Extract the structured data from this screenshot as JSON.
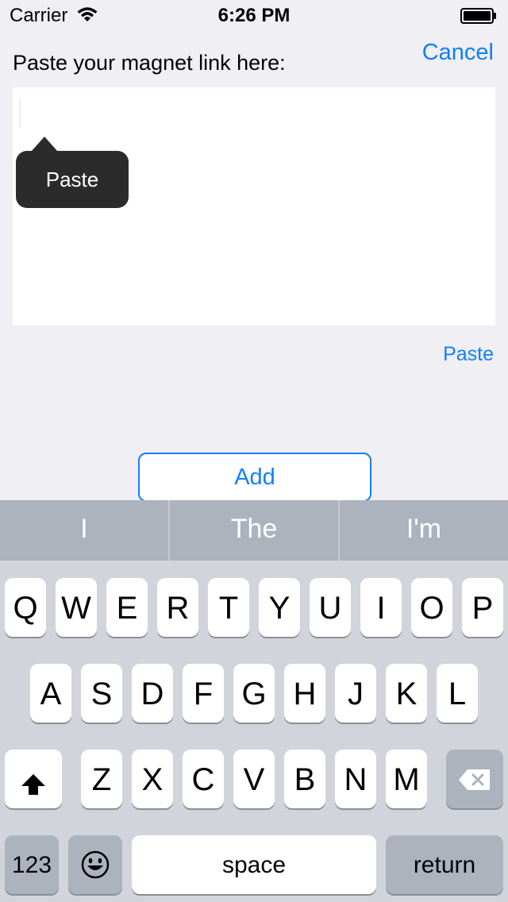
{
  "status_bar": {
    "carrier": "Carrier",
    "time": "6:26 PM",
    "wifi_icon": "wifi-icon",
    "battery_icon": "battery-icon"
  },
  "header": {
    "prompt": "Paste your magnet link here:",
    "cancel_label": "Cancel"
  },
  "text_area": {
    "value": "",
    "popup_label": "Paste"
  },
  "paste_link_label": "Paste",
  "add_button_label": "Add",
  "keyboard": {
    "suggestions": [
      "I",
      "The",
      "I'm"
    ],
    "row1": [
      "Q",
      "W",
      "E",
      "R",
      "T",
      "Y",
      "U",
      "I",
      "O",
      "P"
    ],
    "row2": [
      "A",
      "S",
      "D",
      "F",
      "G",
      "H",
      "J",
      "K",
      "L"
    ],
    "row3": [
      "Z",
      "X",
      "C",
      "V",
      "B",
      "N",
      "M"
    ],
    "numbers_label": "123",
    "space_label": "space",
    "return_label": "return",
    "shift_icon": "shift-icon",
    "emoji_icon": "emoji-icon",
    "delete_icon": "delete-icon"
  },
  "colors": {
    "accent": "#147efb",
    "background": "#efeff4",
    "keyboard_bg": "#d1d5db",
    "suggestion_bg": "#acb3bd"
  }
}
